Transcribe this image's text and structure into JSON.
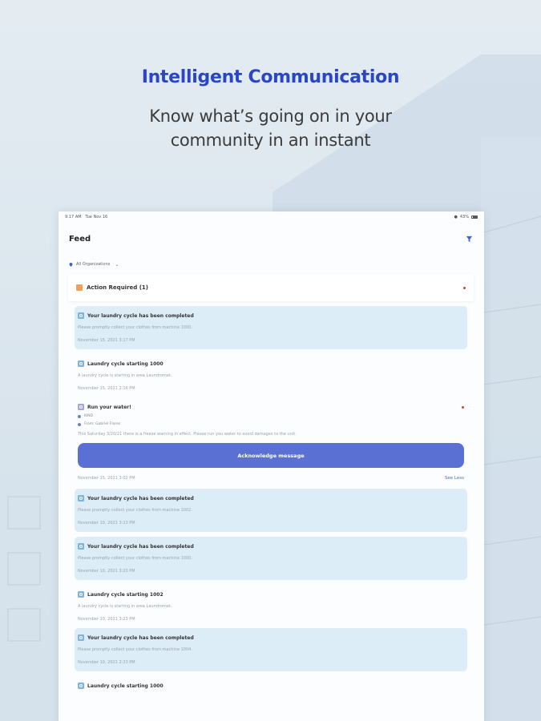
{
  "headline": "Intelligent Communication",
  "subhead": [
    "Know what’s going on in your",
    "community in an instant"
  ],
  "statusbar": {
    "time": "9:17 AM",
    "date": "Tue Nov 16",
    "battery": "43%"
  },
  "feed": {
    "title": "Feed",
    "org_selector": "All Organizations",
    "action_required": "Action Required (1)",
    "items": [
      {
        "type": "laundry",
        "title": "Your laundry cycle has been completed",
        "message": "Please promptly collect your clothes from machine 1000.",
        "date": "November 15, 2021 3:17 PM",
        "highlight": true
      },
      {
        "type": "laundry",
        "title": "Laundry cycle starting 1000",
        "message": "A laundry cycle is starting in area Laundromat.",
        "date": "November 15, 2021 2:16 PM",
        "highlight": false
      }
    ],
    "notice": {
      "title": "Run your water!",
      "tag": "KIND",
      "from": "From: Gabriel Flores",
      "message": "This Saturday 3/20/21 there is a freeze warning in effect. Please run you water to avoid damages to the unit.",
      "button": "Acknowledge message",
      "date": "November 15, 2021 3:02 PM",
      "see_less": "See Less"
    },
    "items_after": [
      {
        "type": "laundry",
        "title": "Your laundry cycle has been completed",
        "message": "Please promptly collect your clothes from machine 1002.",
        "date": "November 10, 2021 3:23 PM",
        "highlight": true
      },
      {
        "type": "laundry",
        "title": "Your laundry cycle has been completed",
        "message": "Please promptly collect your clothes from machine 1000.",
        "date": "November 10, 2021 3:23 PM",
        "highlight": true
      },
      {
        "type": "laundry",
        "title": "Laundry cycle starting 1002",
        "message": "A laundry cycle is starting in area Laundromat.",
        "date": "November 10, 2021 3:23 PM",
        "highlight": false
      },
      {
        "type": "laundry",
        "title": "Your laundry cycle has been completed",
        "message": "Please promptly collect your clothes from machine 1004.",
        "date": "November 10, 2021 2:23 PM",
        "highlight": true
      },
      {
        "type": "laundry",
        "title": "Laundry cycle starting 1000",
        "message": "",
        "date": "",
        "highlight": false
      }
    ]
  },
  "colors": {
    "accent": "#2a45c8",
    "button": "#5a70d3",
    "highlight": "#ddedf7",
    "alert": "#d3412f"
  }
}
